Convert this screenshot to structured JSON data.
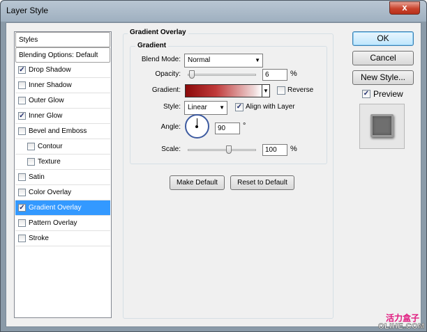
{
  "window": {
    "title": "Layer Style",
    "close_glyph": "x"
  },
  "styles_list": {
    "header": "Styles",
    "items": [
      {
        "label": "Blending Options: Default",
        "checkbox": false,
        "checked": false,
        "indent": false,
        "selected": false
      },
      {
        "label": "Drop Shadow",
        "checkbox": true,
        "checked": true,
        "indent": false,
        "selected": false
      },
      {
        "label": "Inner Shadow",
        "checkbox": true,
        "checked": false,
        "indent": false,
        "selected": false
      },
      {
        "label": "Outer Glow",
        "checkbox": true,
        "checked": false,
        "indent": false,
        "selected": false
      },
      {
        "label": "Inner Glow",
        "checkbox": true,
        "checked": true,
        "indent": false,
        "selected": false
      },
      {
        "label": "Bevel and Emboss",
        "checkbox": true,
        "checked": false,
        "indent": false,
        "selected": false
      },
      {
        "label": "Contour",
        "checkbox": true,
        "checked": false,
        "indent": true,
        "selected": false
      },
      {
        "label": "Texture",
        "checkbox": true,
        "checked": false,
        "indent": true,
        "selected": false
      },
      {
        "label": "Satin",
        "checkbox": true,
        "checked": false,
        "indent": false,
        "selected": false
      },
      {
        "label": "Color Overlay",
        "checkbox": true,
        "checked": false,
        "indent": false,
        "selected": false
      },
      {
        "label": "Gradient Overlay",
        "checkbox": true,
        "checked": true,
        "indent": false,
        "selected": true
      },
      {
        "label": "Pattern Overlay",
        "checkbox": true,
        "checked": false,
        "indent": false,
        "selected": false
      },
      {
        "label": "Stroke",
        "checkbox": true,
        "checked": false,
        "indent": false,
        "selected": false
      }
    ]
  },
  "gradient_overlay": {
    "group_title": "Gradient Overlay",
    "subgroup_title": "Gradient",
    "blend_mode": {
      "label": "Blend Mode:",
      "value": "Normal"
    },
    "opacity": {
      "label": "Opacity:",
      "value": "6",
      "unit": "%",
      "level": 0.06
    },
    "gradient": {
      "label": "Gradient:",
      "start_color": "#8b0a0a",
      "end_color": "#ffffff"
    },
    "reverse": {
      "label": "Reverse",
      "checked": false
    },
    "style": {
      "label": "Style:",
      "value": "Linear"
    },
    "align_with_layer": {
      "label": "Align with Layer",
      "checked": true
    },
    "angle": {
      "label": "Angle:",
      "value": "90",
      "unit": "°"
    },
    "scale": {
      "label": "Scale:",
      "value": "100",
      "unit": "%",
      "level": 0.6
    },
    "make_default": "Make Default",
    "reset_default": "Reset to Default"
  },
  "right_buttons": {
    "ok": "OK",
    "cancel": "Cancel",
    "new_style": "New Style...",
    "preview_label": "Preview",
    "preview_checked": true
  },
  "icons": {
    "check": "✓",
    "dropdown_arrow": "▼"
  },
  "watermark": {
    "line1": "活力盒子",
    "line2": "OLIHE.COM"
  },
  "colors": {
    "selection": "#3399ff",
    "title_bar": "#a9b8c7",
    "close_button": "#c9432d",
    "watermark": "#e0177d"
  }
}
